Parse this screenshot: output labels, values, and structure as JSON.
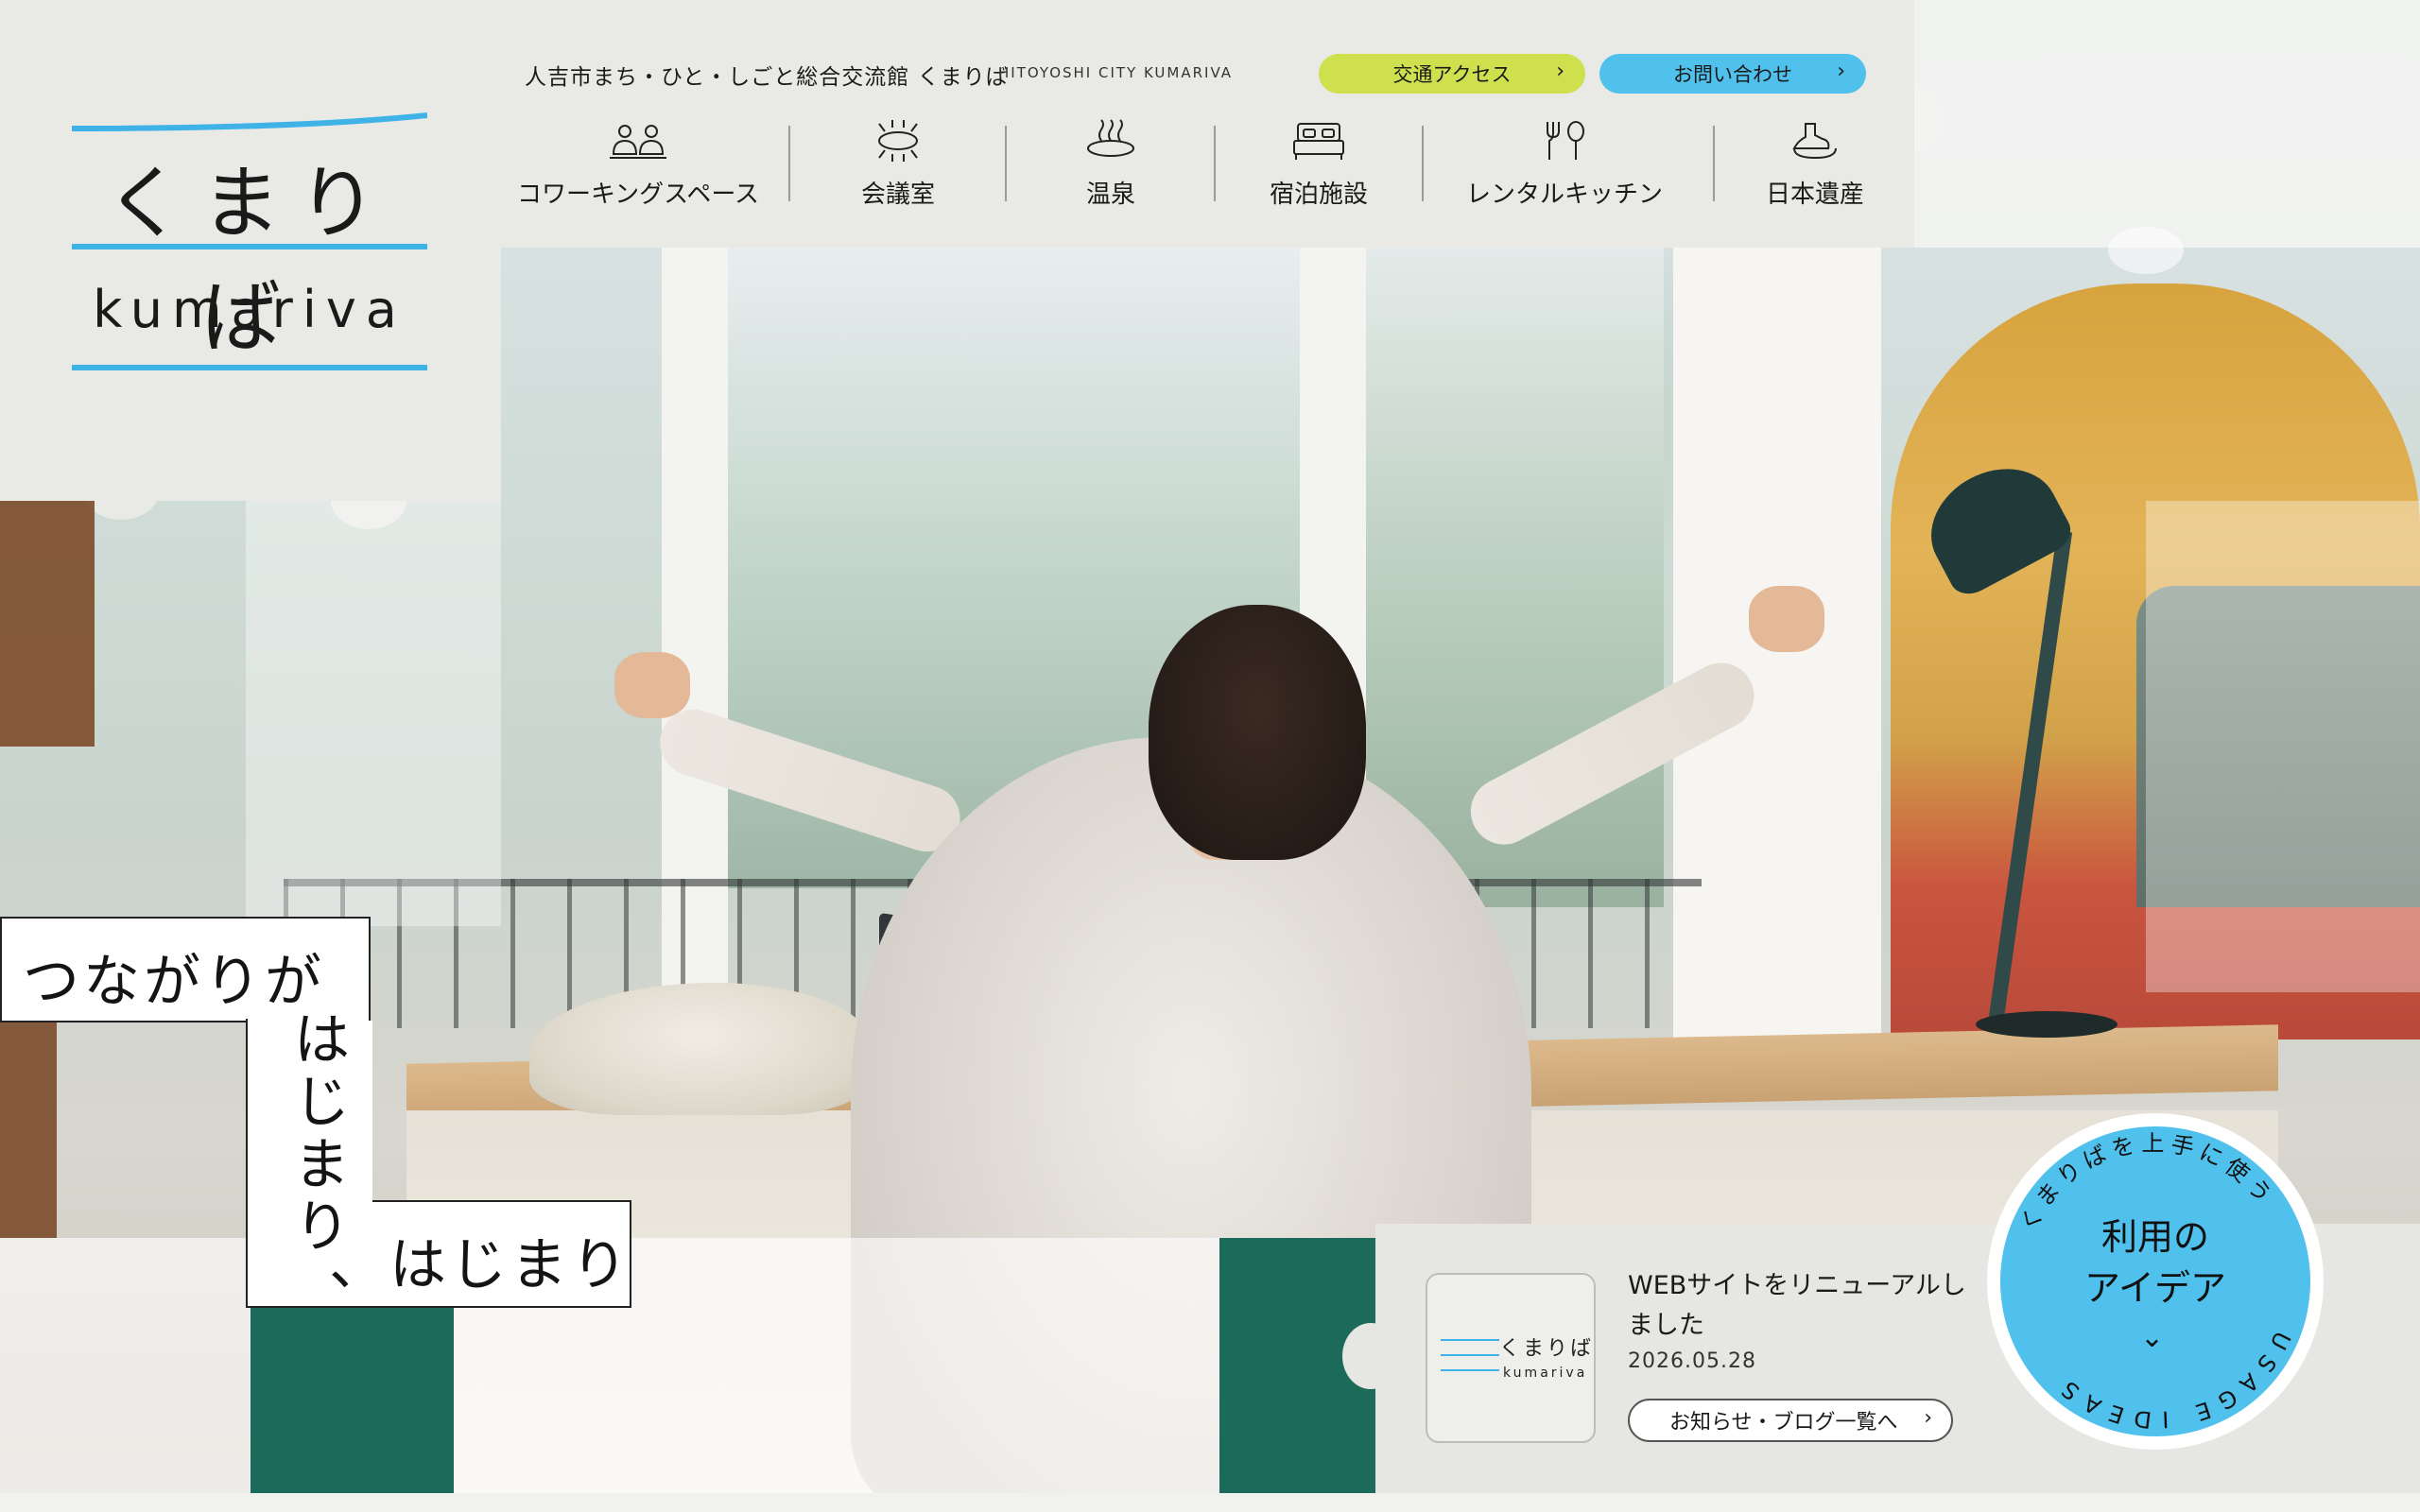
{
  "brand": {
    "logo_jp": "くまりば",
    "logo_en": "kumariva",
    "accent_color": "#3fb3e8"
  },
  "header": {
    "facility_name": "人吉市まち・ひと・しごと総合交流館 くまりば",
    "facility_name_en": "HITOYOSHI CITY KUMARIVA",
    "access_button": "交通アクセス",
    "access_color": "#cfe04f",
    "contact_button": "お問い合わせ",
    "contact_color": "#4fc1ec"
  },
  "nav": {
    "items": [
      {
        "label": "コワーキングスペース",
        "icon": "people-icon"
      },
      {
        "label": "会議室",
        "icon": "meeting-table-icon"
      },
      {
        "label": "温泉",
        "icon": "hot-spring-icon"
      },
      {
        "label": "宿泊施設",
        "icon": "bed-icon"
      },
      {
        "label": "レンタルキッチン",
        "icon": "kitchen-utensils-icon"
      },
      {
        "label": "日本遺産",
        "icon": "heritage-icon"
      }
    ]
  },
  "hero": {
    "copy_line1": "つながりが",
    "copy_line2": "はじまり",
    "copy_line3": "、はじまり"
  },
  "news": {
    "thumb_jp": "くまりば",
    "thumb_en": "kumariva",
    "title": "WEBサイトをリニューアルしました",
    "date": "2026.05.28",
    "more_button": "お知らせ・ブログ一覧へ"
  },
  "usage_badge": {
    "title": "利用の\nアイデア",
    "ring_jp": "くまりばを上手に使う",
    "ring_en": "USAGE IDEAS",
    "color": "#4fc1ec"
  }
}
